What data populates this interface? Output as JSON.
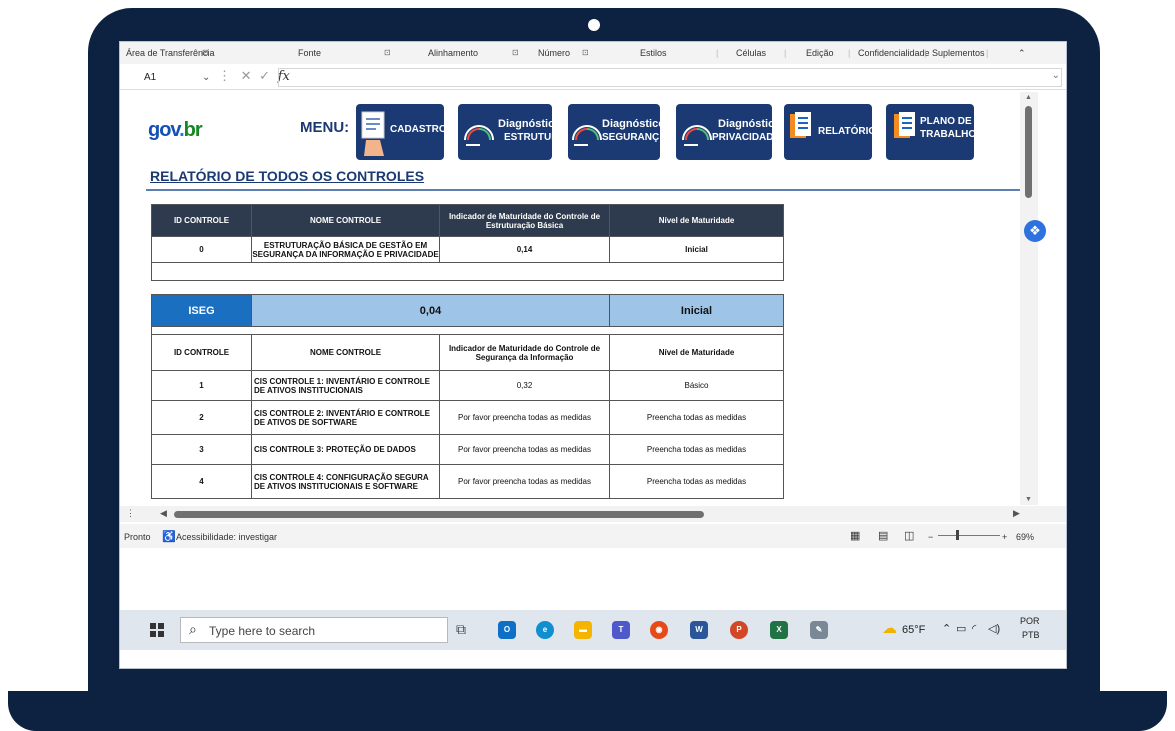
{
  "ribbon": {
    "groups": [
      "Área de Transferência",
      "Fonte",
      "Alinhamento",
      "Número",
      "Estilos",
      "Células",
      "Edição",
      "Confidencialidade",
      "Suplementos"
    ]
  },
  "formula_bar": {
    "cell_ref": "A1",
    "fx_label": "fx",
    "value": ""
  },
  "banner": {
    "logo": {
      "part1": "gov",
      "part2": ".",
      "part3": "br"
    },
    "menu_label": "MENU:",
    "buttons": [
      {
        "line1": "CADASTROS",
        "line2": ""
      },
      {
        "line1": "Diagnóstico",
        "line2": "ESTRUTURA"
      },
      {
        "line1": "Diagnóstico",
        "line2": "SEGURANÇ"
      },
      {
        "line1": "Diagnóstico",
        "line2": "PRIVACIDADE"
      },
      {
        "line1": "RELATÓRIO",
        "line2": ""
      },
      {
        "line1": "PLANO DE",
        "line2": "TRABALHO"
      }
    ]
  },
  "report": {
    "title": "RELATÓRIO DE TODOS OS CONTROLES",
    "table1": {
      "headers": [
        "ID CONTROLE",
        "NOME CONTROLE",
        "Indicador de Maturidade do Controle de Estruturação Básica",
        "Nível de Maturidade"
      ],
      "rows": [
        {
          "id": "0",
          "name": "ESTRUTURAÇÃO BÁSICA DE GESTÃO EM SEGURANÇA DA INFORMAÇÃO E PRIVACIDADE",
          "indicator": "0,14",
          "level": "Inicial"
        }
      ]
    },
    "iseg": {
      "label": "ISEG",
      "value": "0,04",
      "level": "Inicial"
    },
    "table2": {
      "headers": [
        "ID CONTROLE",
        "NOME CONTROLE",
        "Indicador de Maturidade do Controle de Segurança da Informação",
        "Nível de Maturidade"
      ],
      "rows": [
        {
          "id": "1",
          "name": "CIS CONTROLE 1: INVENTÁRIO E CONTROLE DE ATIVOS INSTITUCIONAIS",
          "indicator": "0,32",
          "level": "Básico"
        },
        {
          "id": "2",
          "name": "CIS CONTROLE 2: INVENTÁRIO E CONTROLE DE ATIVOS DE SOFTWARE",
          "indicator": "Por favor preencha todas as medidas",
          "level": "Preencha todas as medidas"
        },
        {
          "id": "3",
          "name": "CIS CONTROLE 3: PROTEÇÃO DE DADOS",
          "indicator": "Por favor preencha todas as medidas",
          "level": "Preencha todas as medidas"
        },
        {
          "id": "4",
          "name": "CIS CONTROLE 4: CONFIGURAÇÃO SEGURA DE ATIVOS INSTITUCIONAIS E SOFTWARE",
          "indicator": "Por favor preencha todas as medidas",
          "level": "Preencha todas as medidas"
        }
      ]
    }
  },
  "status_bar": {
    "ready": "Pronto",
    "accessibility": "Acessibilidade: investigar",
    "zoom": "69%"
  },
  "taskbar": {
    "search_placeholder": "Type here to search",
    "weather": "65°F",
    "lang_line1": "POR",
    "lang_line2": "PTB"
  },
  "colors": {
    "bezel": "#0d2140",
    "nav_button": "#1b3a73",
    "table_header": "#2e3a4d",
    "iseg_label": "#1a6fc1",
    "iseg_value": "#9ec5e8"
  }
}
